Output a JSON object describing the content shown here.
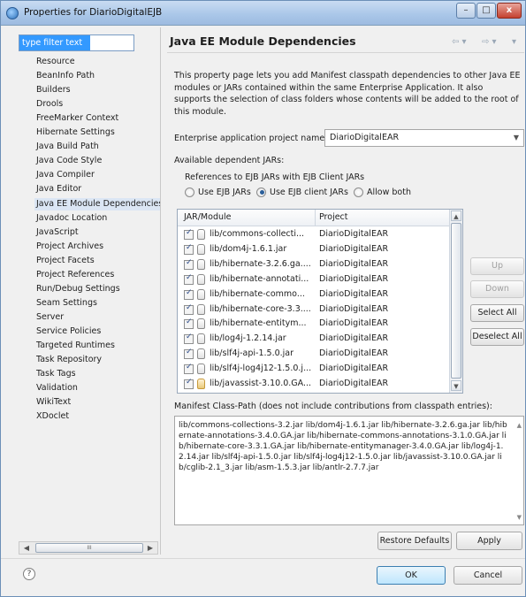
{
  "window": {
    "title": "Properties for DiarioDigitalEJB",
    "minimize": "–",
    "maximize": "□",
    "close": "x"
  },
  "filter": {
    "value": "type filter text"
  },
  "nav": {
    "items": [
      "Resource",
      "BeanInfo Path",
      "Builders",
      "Drools",
      "FreeMarker Context",
      "Hibernate Settings",
      "Java Build Path",
      "Java Code Style",
      "Java Compiler",
      "Java Editor",
      "Java EE Module Dependencies",
      "Javadoc Location",
      "JavaScript",
      "Project Archives",
      "Project Facets",
      "Project References",
      "Run/Debug Settings",
      "Seam Settings",
      "Server",
      "Service Policies",
      "Targeted Runtimes",
      "Task Repository",
      "Task Tags",
      "Validation",
      "WikiText",
      "XDoclet"
    ],
    "selected_index": 10,
    "scroll_thumb": "III"
  },
  "page": {
    "title": "Java EE Module Dependencies",
    "description": "This property page lets you add Manifest classpath dependencies to other Java EE modules or JARs contained within the same Enterprise Application. It also supports the selection of class folders whose contents will be added to the root of this module.",
    "ear_label": "Enterprise application project name:",
    "ear_value": "DiarioDigitalEAR",
    "available_label": "Available dependent JARs:",
    "refs_label": "References to EJB JARs with EJB Client JARs",
    "radios": [
      {
        "label": "Use EJB JARs",
        "selected": false
      },
      {
        "label": "Use EJB client JARs",
        "selected": true
      },
      {
        "label": "Allow both",
        "selected": false
      }
    ]
  },
  "table": {
    "columns": [
      "JAR/Module",
      "Project"
    ],
    "rows": [
      {
        "module": "lib/commons-collecti...",
        "project": "DiarioDigitalEAR"
      },
      {
        "module": "lib/dom4j-1.6.1.jar",
        "project": "DiarioDigitalEAR"
      },
      {
        "module": "lib/hibernate-3.2.6.ga....",
        "project": "DiarioDigitalEAR"
      },
      {
        "module": "lib/hibernate-annotati...",
        "project": "DiarioDigitalEAR"
      },
      {
        "module": "lib/hibernate-commo...",
        "project": "DiarioDigitalEAR"
      },
      {
        "module": "lib/hibernate-core-3.3....",
        "project": "DiarioDigitalEAR"
      },
      {
        "module": "lib/hibernate-entitym...",
        "project": "DiarioDigitalEAR"
      },
      {
        "module": "lib/log4j-1.2.14.jar",
        "project": "DiarioDigitalEAR"
      },
      {
        "module": "lib/slf4j-api-1.5.0.jar",
        "project": "DiarioDigitalEAR"
      },
      {
        "module": "lib/slf4j-log4j12-1.5.0.j...",
        "project": "DiarioDigitalEAR"
      },
      {
        "module": "lib/javassist-3.10.0.GA...",
        "project": "DiarioDigitalEAR"
      }
    ]
  },
  "side_buttons": {
    "up": "Up",
    "down": "Down",
    "select_all": "Select All",
    "deselect_all": "Deselect All"
  },
  "manifest": {
    "label": "Manifest Class-Path (does not include contributions from classpath entries):",
    "text": "lib/commons-collections-3.2.jar lib/dom4j-1.6.1.jar lib/hibernate-3.2.6.ga.jar lib/hibernate-annotations-3.4.0.GA.jar lib/hibernate-commons-annotations-3.1.0.GA.jar lib/hibernate-core-3.3.1.GA.jar lib/hibernate-entitymanager-3.4.0.GA.jar lib/log4j-1.2.14.jar lib/slf4j-api-1.5.0.jar lib/slf4j-log4j12-1.5.0.jar lib/javassist-3.10.0.GA.jar lib/cglib-2.1_3.jar lib/asm-1.5.3.jar lib/antlr-2.7.7.jar"
  },
  "buttons": {
    "restore_defaults": "Restore Defaults",
    "apply": "Apply",
    "ok": "OK",
    "cancel": "Cancel",
    "help": "?"
  }
}
